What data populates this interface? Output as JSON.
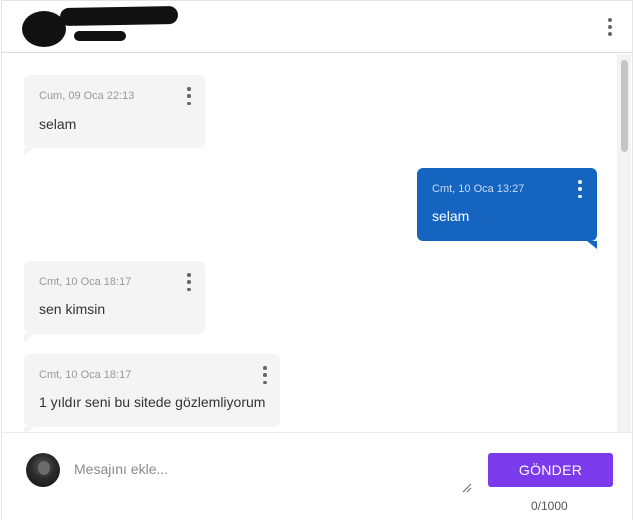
{
  "header": {
    "more_icon": "more-vertical-icon"
  },
  "messages": [
    {
      "direction": "in",
      "timestamp": "Cum, 09 Oca 22:13",
      "text": "selam"
    },
    {
      "direction": "out",
      "timestamp": "Cmt, 10 Oca 13:27",
      "text": "selam"
    },
    {
      "direction": "in",
      "timestamp": "Cmt, 10 Oca 18:17",
      "text": "sen kimsin"
    },
    {
      "direction": "in",
      "timestamp": "Cmt, 10 Oca 18:17",
      "text": "1 yıldır seni bu sitede gözlemliyorum"
    }
  ],
  "composer": {
    "placeholder": "Mesajını ekle...",
    "value": "",
    "send_label": "GÖNDER",
    "counter": "0/1000"
  },
  "colors": {
    "outgoing_bubble": "#1565c0",
    "incoming_bubble": "#f4f4f4",
    "send_button": "#7c3aed"
  }
}
